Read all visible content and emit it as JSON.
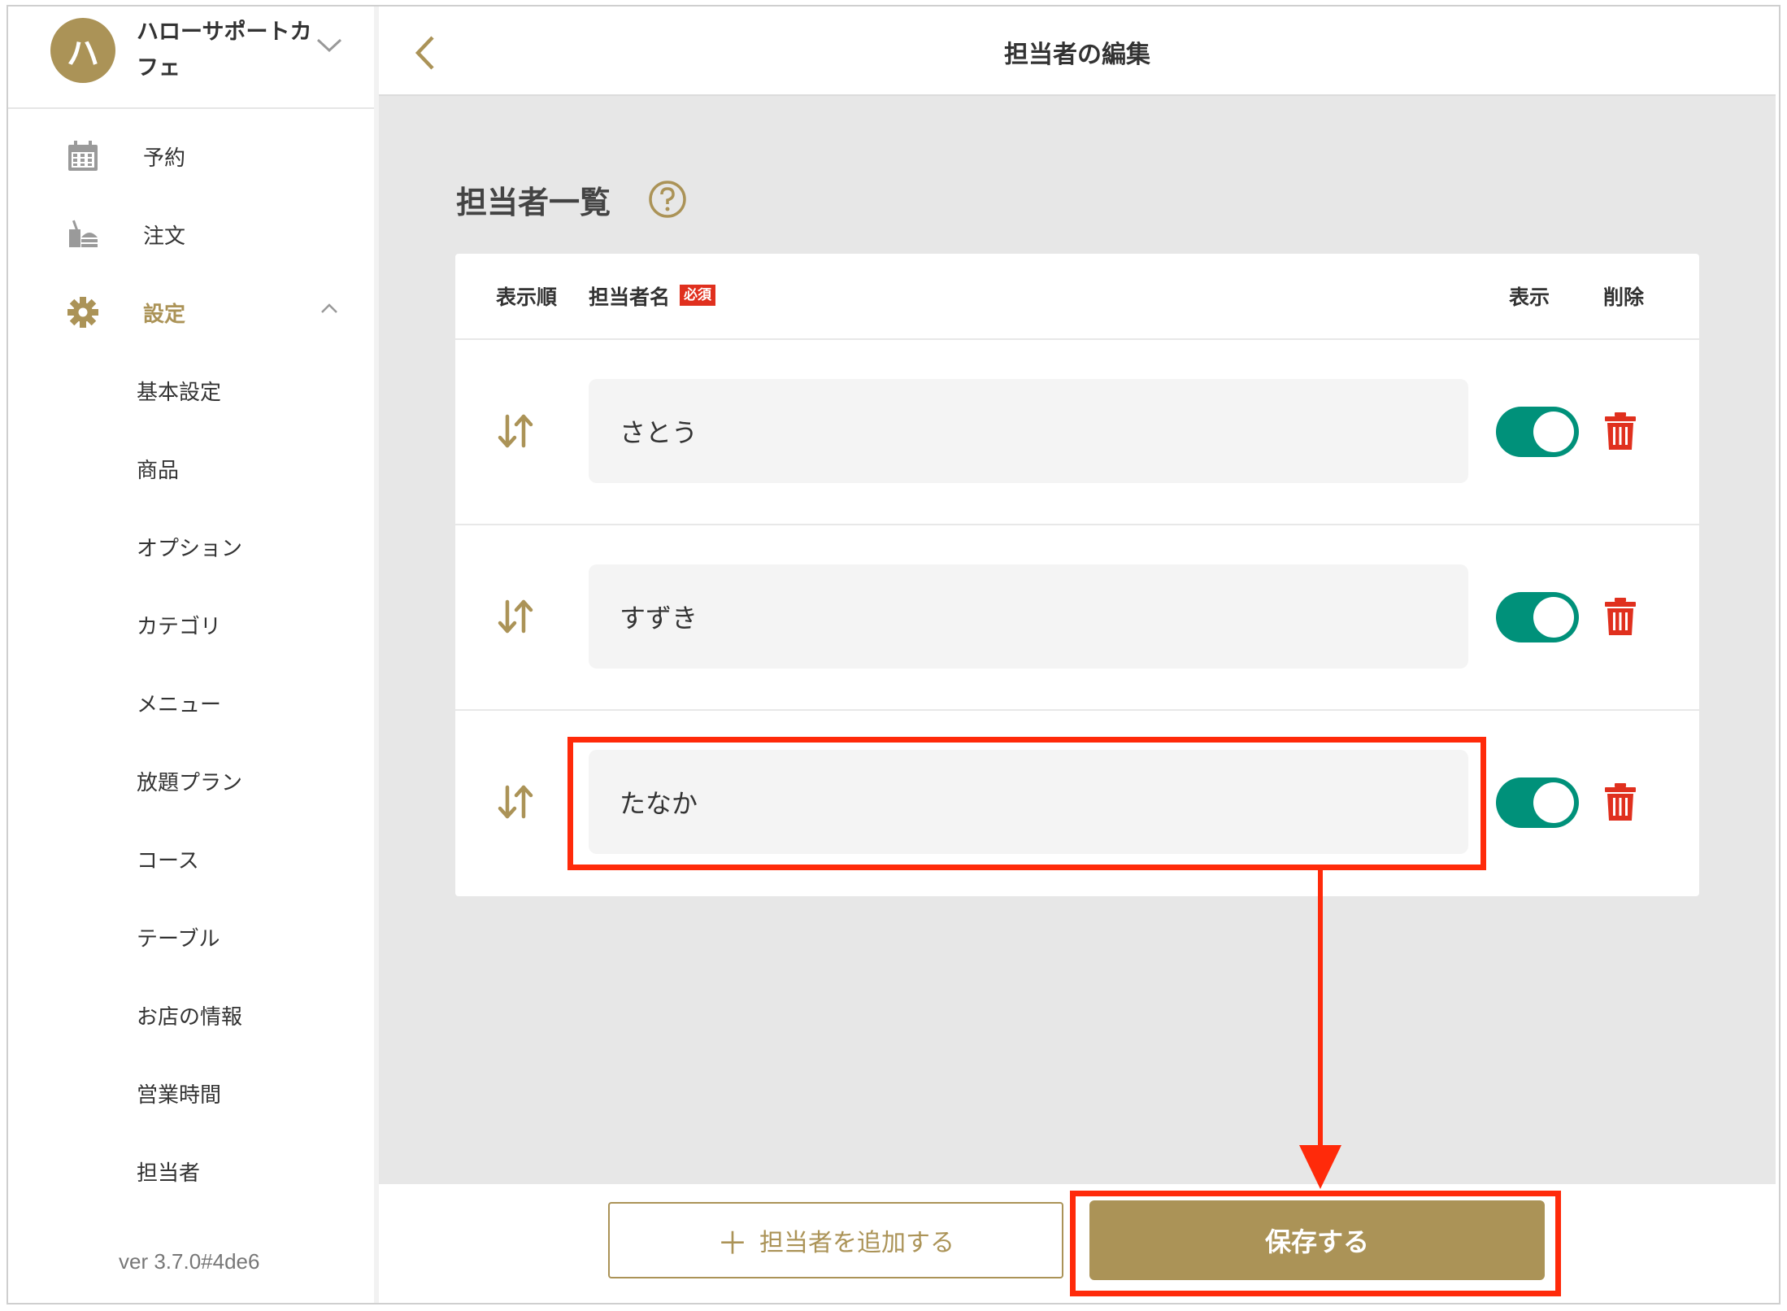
{
  "sidebar": {
    "avatar_initial": "ハ",
    "shop_name": "ハローサポートカフェ",
    "nav": [
      {
        "label": "予約",
        "icon": "calendar-icon"
      },
      {
        "label": "注文",
        "icon": "order-tray-icon"
      },
      {
        "label": "設定",
        "icon": "gear-icon",
        "active": true
      }
    ],
    "sub_items": [
      "基本設定",
      "商品",
      "オプション",
      "カテゴリ",
      "メニュー",
      "放題プラン",
      "コース",
      "テーブル",
      "お店の情報",
      "営業時間",
      "担当者"
    ],
    "version": "ver 3.7.0#4de6"
  },
  "header": {
    "title": "担当者の編集",
    "back_icon": "chevron-left-icon"
  },
  "section": {
    "title": "担当者一覧",
    "help_icon": "question-circle-icon"
  },
  "table": {
    "columns": {
      "order": "表示順",
      "name": "担当者名",
      "required": "必須",
      "show": "表示",
      "delete": "削除"
    },
    "rows": [
      {
        "name": "さとう",
        "visible": true
      },
      {
        "name": "すずき",
        "visible": true
      },
      {
        "name": "たなか",
        "visible": true
      }
    ]
  },
  "footer": {
    "add_plus": "＋",
    "add_label": "担当者を追加する",
    "save_label": "保存する"
  },
  "colors": {
    "accent": "#ab9357",
    "toggle_on": "#00917a",
    "delete": "#e0301e",
    "annotation": "#ff2a0a"
  }
}
